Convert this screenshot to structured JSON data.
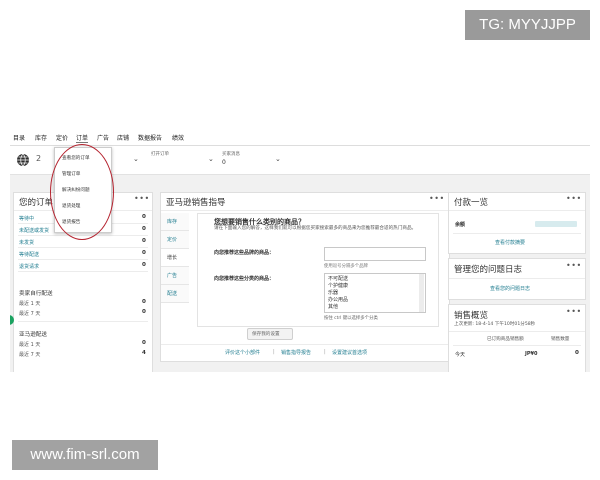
{
  "watermarks": {
    "top": "TG: MYYJJPP",
    "bottom": "www.fim-srl.com"
  },
  "nav": {
    "items": [
      "目录",
      "库存",
      "定价",
      "订单",
      "广告",
      "店铺",
      "数据报告",
      "绩效"
    ],
    "active_index": 3
  },
  "subbar": {
    "marketplace_count": "2",
    "field1_label": "打开订单",
    "field2_label": "买家消息",
    "field2_value": "0"
  },
  "dropdown": {
    "items": [
      "查看您的订单",
      "管理订单",
      "解决纠纷问题",
      "退货处理",
      "退货报告"
    ]
  },
  "orders": {
    "title": "您的订单",
    "rows": [
      {
        "label": "等待中",
        "value": "0"
      },
      {
        "label": "未配送或发货",
        "value": "0"
      },
      {
        "label": "未发货",
        "value": "0"
      },
      {
        "label": "等待配送",
        "value": "0"
      },
      {
        "label": "退货请求",
        "value": "0"
      }
    ],
    "seller_section": "卖家自行配送",
    "seller_rows": [
      {
        "label": "最近 1 天",
        "value": "0"
      },
      {
        "label": "最近 7 天",
        "value": "0"
      }
    ],
    "fba_section": "亚马逊配送",
    "fba_rows": [
      {
        "label": "最近 1 天",
        "value": "0"
      },
      {
        "label": "最近 7 天",
        "value": "4"
      }
    ]
  },
  "guide": {
    "title": "亚马逊销售指导",
    "tabs": [
      "库存",
      "定价",
      "增长",
      "广告",
      "配送"
    ],
    "active_tab": 2,
    "heading": "您想要销售什么类别的商品？",
    "description": "请在下面输入您的解答，这样我们就可以根据您买家搜索最多的商品来为您推荐最合适的热门商品。",
    "q1_label": "向您推荐这些品牌的商品：",
    "q1_hint": "使用逗号分隔多个品牌",
    "q2_label": "向您推荐这些分类的商品：",
    "categories": [
      "不可配送",
      "个护健康",
      "乐器",
      "办公用品",
      "其他"
    ],
    "categories_hint": "按住 ctrl 键以选择多个分类",
    "submit": "保存我的设置",
    "footer_links": [
      "评价这个小部件",
      "销售指导报告",
      "设置建议首选项"
    ],
    "footer_sep": "|"
  },
  "payments": {
    "title": "付款一览",
    "total_label": "余额",
    "link": "查看付款摘要"
  },
  "issues": {
    "title": "管理您的问题日志",
    "link": "查看您的问题日志"
  },
  "sales": {
    "title": "销售概览",
    "updated": "上次更新: 18-4-14 下午10时01分58秒",
    "col1": "已订购商品销售额",
    "col2": "销售数量",
    "row_label": "今天",
    "row_value": "JP¥0",
    "row_count": "0"
  },
  "more_label": "•••",
  "chevron": "⌄",
  "icons": [
    "globe-icon",
    "chevron-down-icon",
    "more-icon"
  ],
  "colors": {
    "accent": "#1f7c8f",
    "highlight": "#b5232f",
    "bg": "#f1f1f1"
  }
}
